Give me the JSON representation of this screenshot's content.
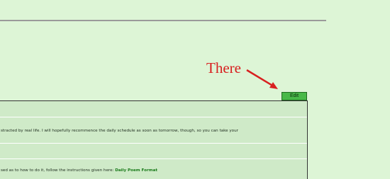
{
  "annotation": {
    "text": "There"
  },
  "toolbar": {
    "edit_label": "Edit"
  },
  "panel": {
    "rows": [
      {
        "text": ""
      },
      {
        "text": "stracted by real life. I will hopefully recommence the daily schedule as soon as tomorrow, though, so you can take your"
      },
      {
        "text": ""
      },
      {
        "text": "sed as to how to do it, follow the instructions given here:",
        "link": "Daily Poem Format"
      }
    ]
  },
  "colors": {
    "page": "#ddf5d6",
    "panel": "#cfeac8",
    "annotation": "#d82020",
    "button": "#48b848",
    "link": "#1a7a1a"
  }
}
